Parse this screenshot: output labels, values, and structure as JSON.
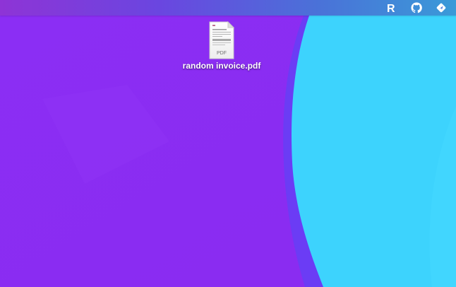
{
  "desktop": {
    "colors": {
      "purple": "#8a2cf5",
      "blue_wave": "#3dd2fd",
      "wave_edge": "#6a3cf6"
    },
    "files": [
      {
        "name": "random invoice.pdf",
        "icon": "pdf-file-icon",
        "icon_badge": "PDF"
      }
    ]
  },
  "menubar": {
    "items": [
      {
        "name": "r-app-icon",
        "glyph": "R"
      },
      {
        "name": "github-icon"
      },
      {
        "name": "location-arrow-icon"
      }
    ]
  }
}
